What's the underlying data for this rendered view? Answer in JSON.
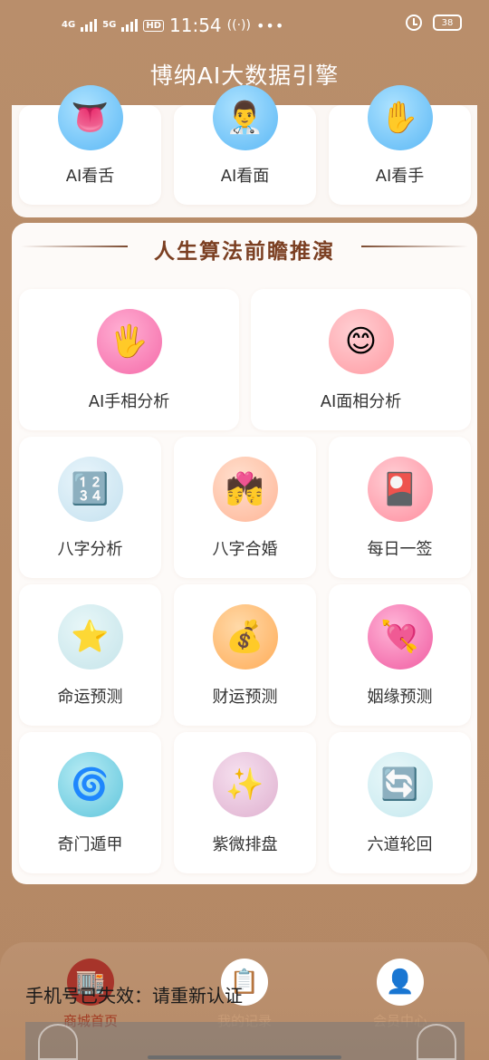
{
  "status_bar": {
    "signal1": "4G",
    "signal2": "5G",
    "hd": "HD",
    "time": "11:54",
    "battery": "38"
  },
  "app_title": "博纳AI大数据引擎",
  "top_section": {
    "items": [
      {
        "label": "AI看舌",
        "icon": "tongue-icon",
        "emoji": "👅"
      },
      {
        "label": "AI看面",
        "icon": "doctor-icon",
        "emoji": "👨‍⚕️"
      },
      {
        "label": "AI看手",
        "icon": "hand-icon",
        "emoji": "✋"
      }
    ]
  },
  "main_section": {
    "title": "人生算法前瞻推演",
    "featured": [
      {
        "label": "AI手相分析",
        "icon": "palm-icon",
        "emoji": "🖐️",
        "color": "#ff7ab8"
      },
      {
        "label": "AI面相分析",
        "icon": "smile-icon",
        "emoji": "😊",
        "color": "#ff9aa2"
      }
    ],
    "grid": [
      {
        "label": "八字分析",
        "icon": "numbers-icon",
        "emoji": "🔢",
        "color": "#cfe6f2"
      },
      {
        "label": "八字合婚",
        "icon": "couple-icon",
        "emoji": "💏",
        "color": "#ffc2a8"
      },
      {
        "label": "每日一签",
        "icon": "flower-card-icon",
        "emoji": "🎴",
        "color": "#ff9aa8"
      },
      {
        "label": "命运预测",
        "icon": "star-icon",
        "emoji": "⭐",
        "color": "#cdebef"
      },
      {
        "label": "财运预测",
        "icon": "money-bag-icon",
        "emoji": "💰",
        "color": "#ffb86b"
      },
      {
        "label": "姻缘预测",
        "icon": "heart-arrow-icon",
        "emoji": "💘",
        "color": "#ff6fb0"
      },
      {
        "label": "奇门遁甲",
        "icon": "cyclone-icon",
        "emoji": "🌀",
        "color": "#7fd6e6"
      },
      {
        "label": "紫微排盘",
        "icon": "sparkles-icon",
        "emoji": "✨",
        "color": "#e6bedb"
      },
      {
        "label": "六道轮回",
        "icon": "cycle-arrows-icon",
        "emoji": "🔄",
        "color": "#cfeef2"
      }
    ]
  },
  "tabbar": {
    "tabs": [
      {
        "label": "商城首页",
        "icon": "shop-icon",
        "emoji": "🏬"
      },
      {
        "label": "我的记录",
        "icon": "clipboard-icon",
        "emoji": "📋"
      },
      {
        "label": "会员中心",
        "icon": "user-icon",
        "emoji": "👤"
      }
    ]
  },
  "toast": "手机号已失效：请重新认证"
}
